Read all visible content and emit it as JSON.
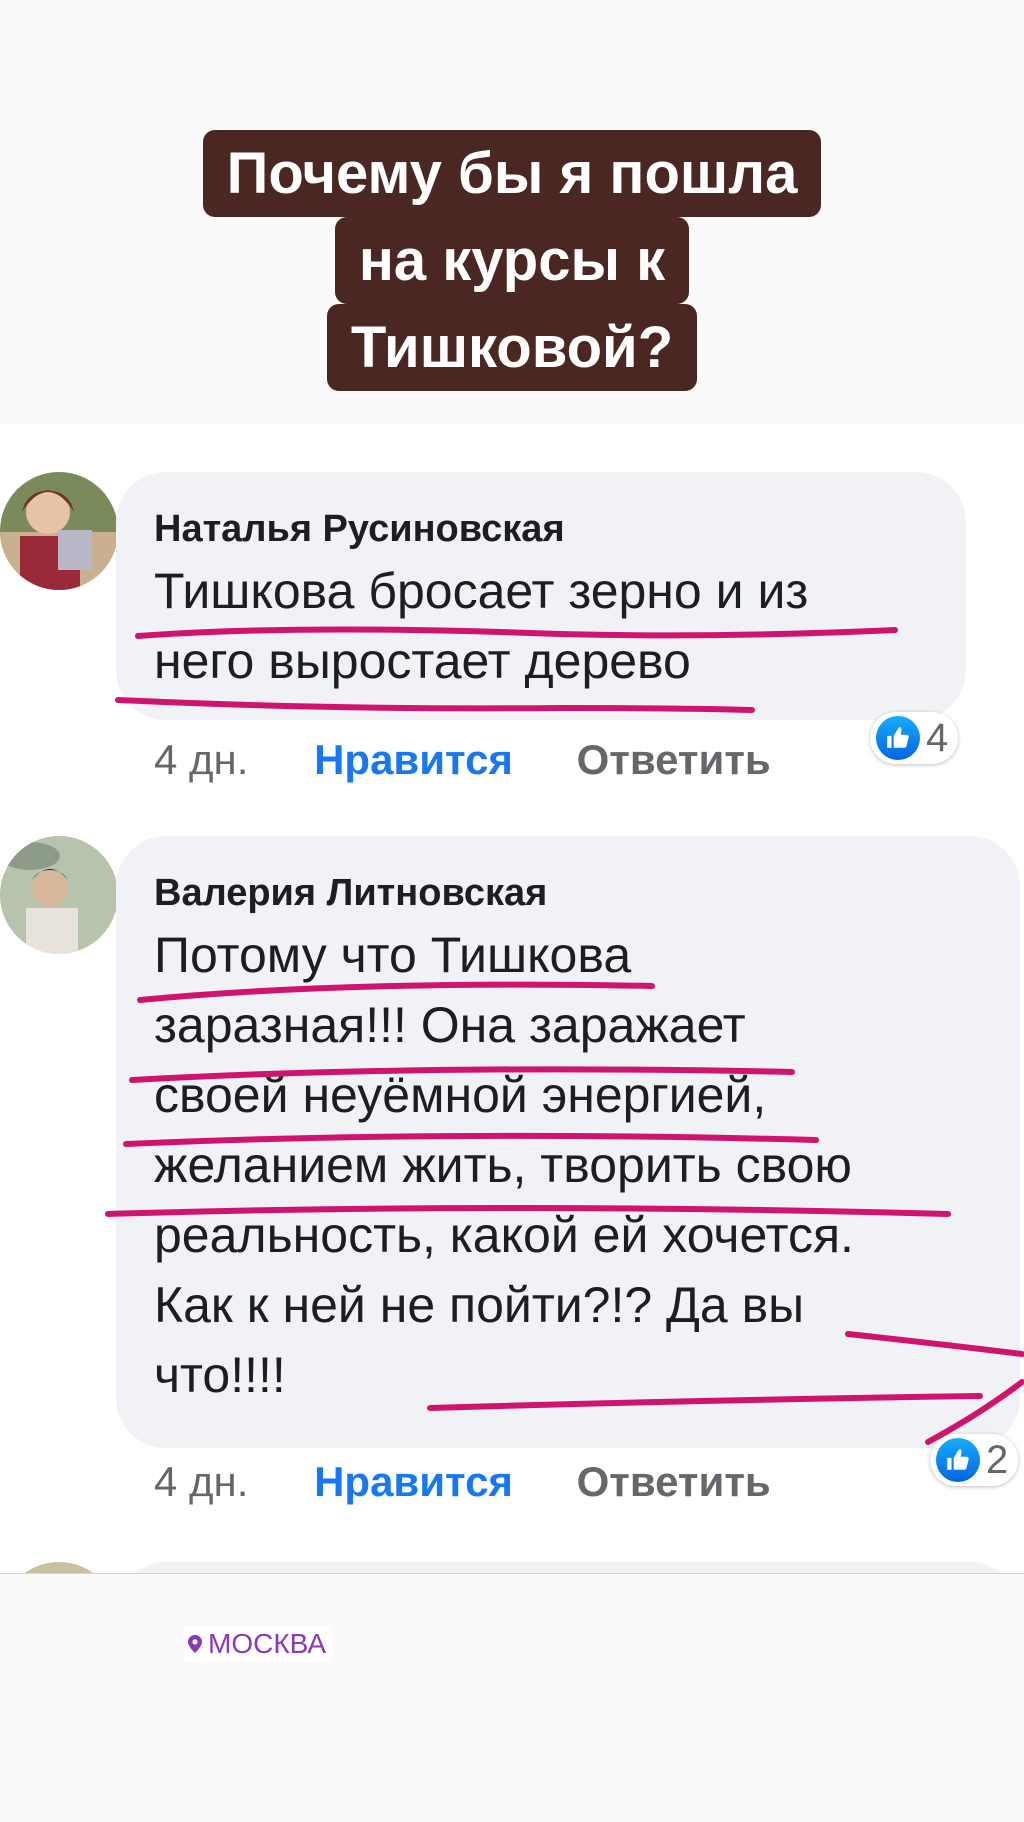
{
  "story": {
    "title_lines": [
      "Почему бы я пошла",
      "на курсы к",
      "Тишковой?"
    ]
  },
  "comments": [
    {
      "author": "Наталья Русиновская",
      "text_lines": [
        "Тишкова бросает зерно и из",
        "него выростает дерево"
      ],
      "time": "4 дн.",
      "like_label": "Нравится",
      "reply_label": "Ответить",
      "reaction_count": "4"
    },
    {
      "author": "Валерия Литновская",
      "text_lines": [
        "Потому что Тишкова",
        "заразная!!! Она заражает",
        "своей неуёмной энергией,",
        "желанием жить, творить свою",
        "реальность, какой ей хочется.",
        "Как к ней не пойти?!? Да вы",
        "что!!!!"
      ],
      "time": "4 дн.",
      "like_label": "Нравится",
      "reply_label": "Ответить",
      "reaction_count": "2"
    }
  ],
  "location_sticker": {
    "label": "МОСКВА",
    "icon": "location-pin-icon"
  },
  "colors": {
    "title_bg": "#4a2723",
    "underline": "#d0146e",
    "like_blue": "#1877f2",
    "bubble_bg": "#f0f2f5",
    "location": "#8a3ab9"
  }
}
